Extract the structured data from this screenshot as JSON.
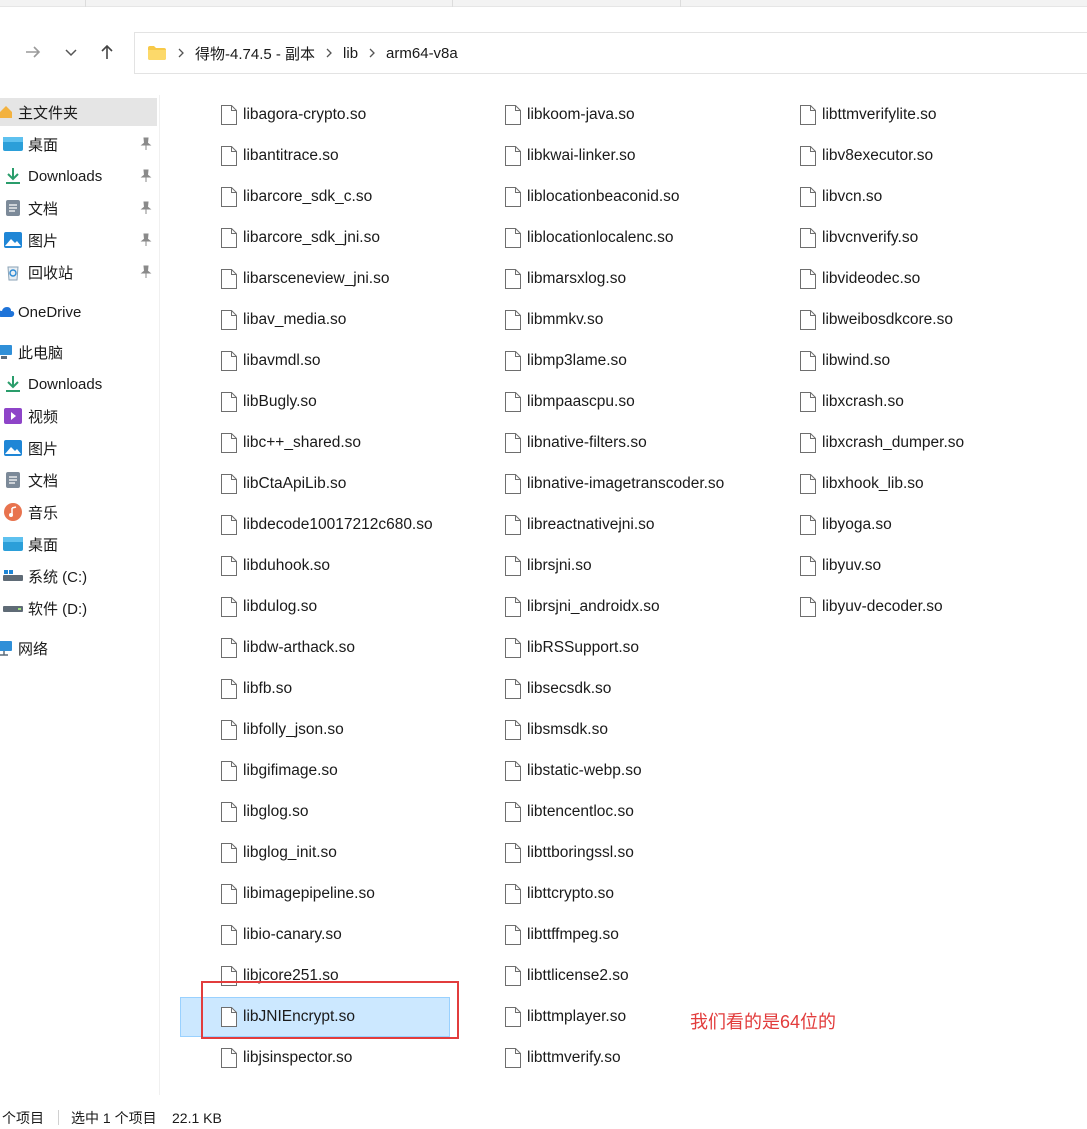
{
  "address_bar": {
    "crumbs": [
      "得物-4.74.5 - 副本",
      "lib",
      "arm64-v8a"
    ]
  },
  "sidebar": {
    "quick_access": "主文件夹",
    "pinned": [
      {
        "label": "桌面",
        "icon": "desktop-icon"
      },
      {
        "label": "Downloads",
        "icon": "download-icon"
      },
      {
        "label": "文档",
        "icon": "document-icon"
      },
      {
        "label": "图片",
        "icon": "picture-icon"
      },
      {
        "label": "回收站",
        "icon": "recycle-bin-icon"
      }
    ],
    "onedrive": "OneDrive",
    "this_pc": "此电脑",
    "pc_items": [
      {
        "label": "Downloads",
        "icon": "download-icon"
      },
      {
        "label": "视频",
        "icon": "video-icon"
      },
      {
        "label": "图片",
        "icon": "picture-icon"
      },
      {
        "label": "文档",
        "icon": "document-icon"
      },
      {
        "label": "音乐",
        "icon": "music-icon"
      },
      {
        "label": "桌面",
        "icon": "desktop-icon"
      },
      {
        "label": "系统 (C:)",
        "icon": "drive-icon"
      },
      {
        "label": "软件 (D:)",
        "icon": "drive-icon"
      }
    ],
    "network": "网络"
  },
  "files": {
    "col1": [
      "libagora-crypto.so",
      "libantitrace.so",
      "libarcore_sdk_c.so",
      "libarcore_sdk_jni.so",
      "libarsceneview_jni.so",
      "libav_media.so",
      "libavmdl.so",
      "libBugly.so",
      "libc++_shared.so",
      "libCtaApiLib.so",
      "libdecode10017212c680.so",
      "libduhook.so",
      "libdulog.so",
      "libdw-arthack.so",
      "libfb.so",
      "libfolly_json.so",
      "libgifimage.so",
      "libglog.so",
      "libglog_init.so",
      "libimagepipeline.so",
      "libio-canary.so",
      "libjcore251.so",
      "libJNIEncrypt.so",
      "libjsinspector.so"
    ],
    "col2": [
      "libkoom-java.so",
      "libkwai-linker.so",
      "liblocationbeaconid.so",
      "liblocationlocalenc.so",
      "libmarsxlog.so",
      "libmmkv.so",
      "libmp3lame.so",
      "libmpaascpu.so",
      "libnative-filters.so",
      "libnative-imagetranscoder.so",
      "libreactnativejni.so",
      "librsjni.so",
      "librsjni_androidx.so",
      "libRSSupport.so",
      "libsecsdk.so",
      "libsmsdk.so",
      "libstatic-webp.so",
      "libtencentloc.so",
      "libttboringssl.so",
      "libttcrypto.so",
      "libttffmpeg.so",
      "libttlicense2.so",
      "libttmplayer.so",
      "libttmverify.so"
    ],
    "col3": [
      "libttmverifylite.so",
      "libv8executor.so",
      "libvcn.so",
      "libvcnverify.so",
      "libvideodec.so",
      "libweibosdkcore.so",
      "libwind.so",
      "libxcrash.so",
      "libxcrash_dumper.so",
      "libxhook_lib.so",
      "libyoga.so",
      "libyuv.so",
      "libyuv-decoder.so"
    ],
    "selected": "libJNIEncrypt.so"
  },
  "annotation": "我们看的是64位的",
  "status_bar": {
    "item_count": "个项目",
    "selection": "选中 1 个项目",
    "size": "22.1 KB"
  },
  "colors": {
    "selection_bg": "#cce8ff",
    "annotation_red": "#e23c3c",
    "folder_yellow": "#f7c948"
  }
}
